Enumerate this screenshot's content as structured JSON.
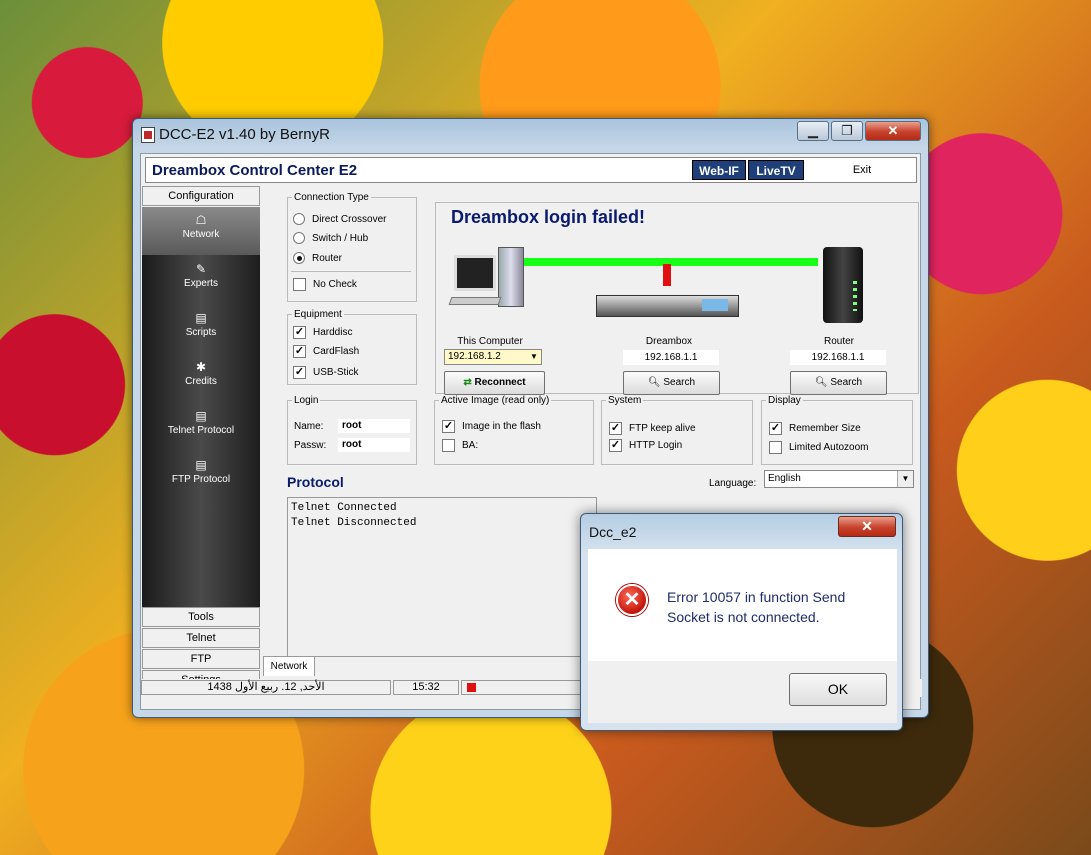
{
  "window": {
    "title": "DCC-E2 v1.40 by BernyR",
    "minimize": "▁",
    "maximize": "❐",
    "close": "✕"
  },
  "header": {
    "app_title": "Dreambox Control Center E2",
    "webif": "Web-IF",
    "livetv": "LiveTV",
    "exit": "Exit"
  },
  "sidebar": {
    "configuration": "Configuration",
    "items": [
      {
        "label": "Network",
        "icon": "network-icon"
      },
      {
        "label": "Experts",
        "icon": "experts-icon"
      },
      {
        "label": "Scripts",
        "icon": "document-icon"
      },
      {
        "label": "Credits",
        "icon": "credits-icon"
      },
      {
        "label": "Telnet Protocol",
        "icon": "document-icon"
      },
      {
        "label": "FTP Protocol",
        "icon": "document-icon"
      }
    ],
    "bottom_tabs": [
      "Tools",
      "Telnet",
      "FTP",
      "Settings"
    ]
  },
  "connection_type": {
    "legend": "Connection Type",
    "options": [
      "Direct Crossover",
      "Switch / Hub",
      "Router"
    ],
    "selected": "Router",
    "no_check": "No Check"
  },
  "equipment": {
    "legend": "Equipment",
    "items": [
      "Harddisc",
      "CardFlash",
      "USB-Stick"
    ]
  },
  "network_panel": {
    "status": "Dreambox login failed!",
    "this_computer": "This Computer",
    "dreambox": "Dreambox",
    "router": "Router",
    "computer_ip": "192.168.1.2",
    "dreambox_ip": "192.168.1.1",
    "router_ip": "192.168.1.1",
    "reconnect": "Reconnect",
    "search": "Search"
  },
  "login": {
    "legend": "Login",
    "name_label": "Name:",
    "name_value": "root",
    "passw_label": "Passw:",
    "passw_value": "root"
  },
  "active_image": {
    "legend": "Active Image (read only)",
    "image_in_flash": "Image in the flash",
    "ba": "BA:"
  },
  "system": {
    "legend": "System",
    "ftp_keep_alive": "FTP keep alive",
    "http_login": "HTTP Login"
  },
  "display": {
    "legend": "Display",
    "remember_size": "Remember Size",
    "limited_autozoom": "Limited Autozoom"
  },
  "protocol": {
    "title": "Protocol",
    "language_label": "Language:",
    "language_value": "English",
    "log": [
      "Telnet Connected",
      "Telnet Disconnected"
    ]
  },
  "tabs": {
    "network": "Network"
  },
  "status": {
    "date": "الأحد, 12. ربيع الأول 1438",
    "time": "15:32"
  },
  "dialog": {
    "title": "Dcc_e2",
    "close": "✕",
    "line1": "Error 10057 in function Send",
    "line2": "Socket is not connected.",
    "ok": "OK"
  },
  "colors": {
    "accent_title": "#0a1a6c",
    "link_green": "#18ff18",
    "link_red": "#e01010"
  }
}
